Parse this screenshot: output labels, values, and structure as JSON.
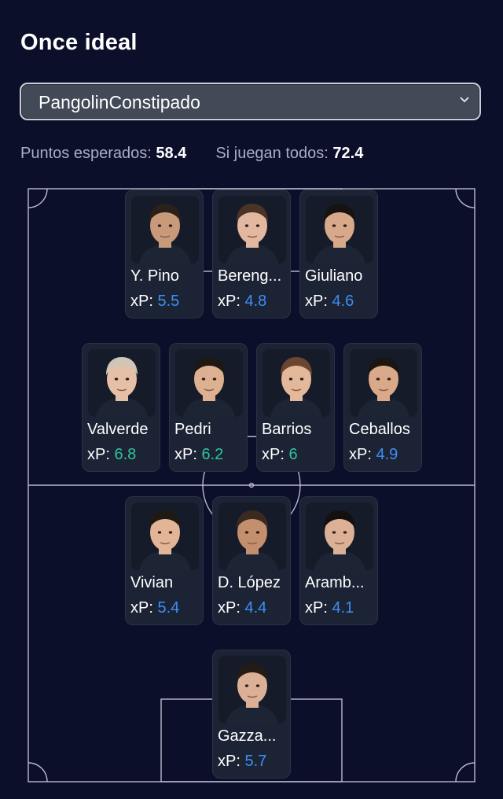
{
  "title": "Once ideal",
  "team_select": {
    "value": "PangolinConstipado"
  },
  "stats": {
    "expected_label": "Puntos esperados:",
    "expected_value": "58.4",
    "all_play_label": "Si juegan todos:",
    "all_play_value": "72.4"
  },
  "xp_label": "xP:",
  "colors": {
    "xp_blue": "#3d8ff3",
    "xp_green": "#2fc49a",
    "background": "#0c0f2a"
  },
  "players": [
    {
      "name": "Y. Pino",
      "xp": "5.5",
      "color": "blue",
      "skin": "#c89a7a",
      "hair": "#2b201a"
    },
    {
      "name": "Bereng...",
      "xp": "4.8",
      "color": "blue",
      "skin": "#e3b8a0",
      "hair": "#4a3426"
    },
    {
      "name": "Giuliano",
      "xp": "4.6",
      "color": "blue",
      "skin": "#d7a98a",
      "hair": "#171312"
    },
    {
      "name": "Valverde",
      "xp": "6.8",
      "color": "green",
      "skin": "#e6c0a6",
      "hair": "#cfc6b8"
    },
    {
      "name": "Pedri",
      "xp": "6.2",
      "color": "green",
      "skin": "#ddb092",
      "hair": "#1e1813"
    },
    {
      "name": "Barrios",
      "xp": "6",
      "color": "green",
      "skin": "#e4b89a",
      "hair": "#6a4630"
    },
    {
      "name": "Ceballos",
      "xp": "4.9",
      "color": "blue",
      "skin": "#d9a98a",
      "hair": "#1c1612"
    },
    {
      "name": "Vivian",
      "xp": "5.4",
      "color": "blue",
      "skin": "#e2b596",
      "hair": "#1f1914"
    },
    {
      "name": "D. López",
      "xp": "4.4",
      "color": "blue",
      "skin": "#c48f6c",
      "hair": "#3a2a20"
    },
    {
      "name": "Aramb...",
      "xp": "4.1",
      "color": "blue",
      "skin": "#dcb094",
      "hair": "#141010"
    },
    {
      "name": "Gazza...",
      "xp": "5.7",
      "color": "blue",
      "skin": "#dcb096",
      "hair": "#241b16"
    }
  ]
}
